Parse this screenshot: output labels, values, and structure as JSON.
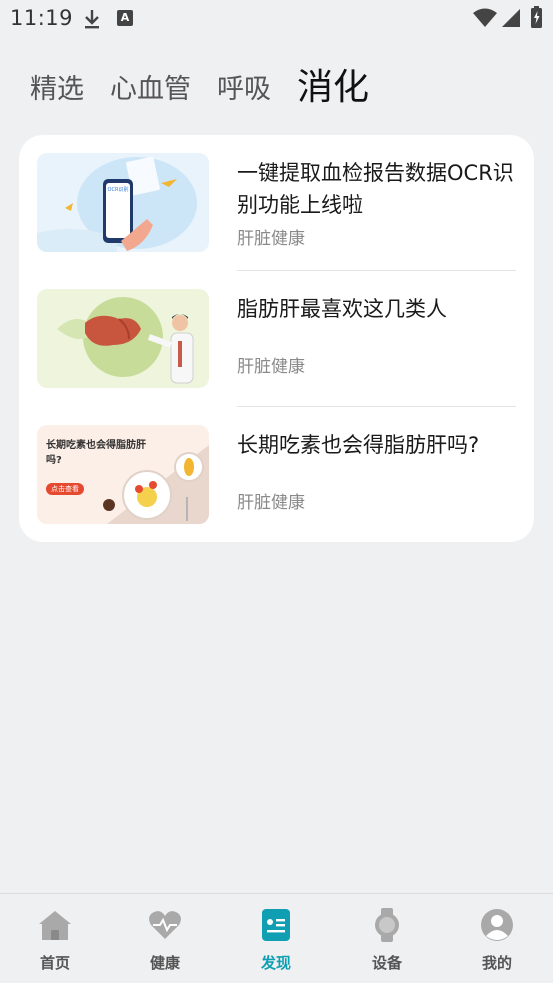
{
  "status_bar": {
    "time": "11:19",
    "icons": [
      "download-icon",
      "app-a-icon",
      "wifi-icon",
      "signal-icon",
      "battery-icon"
    ]
  },
  "tabs": [
    {
      "label": "精选",
      "active": false
    },
    {
      "label": "心血管",
      "active": false
    },
    {
      "label": "呼吸",
      "active": false
    },
    {
      "label": "消化",
      "active": true
    }
  ],
  "articles": [
    {
      "title": "一键提取血检报告数据OCR识别功能上线啦",
      "source": "肝脏健康",
      "thumbnail": {
        "icon": "phone-ocr-illustration",
        "text": "OCR识别"
      }
    },
    {
      "title": "脂肪肝最喜欢这几类人",
      "source": "肝脏健康",
      "thumbnail": {
        "icon": "liver-doctor-illustration"
      }
    },
    {
      "title": "长期吃素也会得脂肪肝吗?",
      "source": "肝脏健康",
      "thumbnail": {
        "icon": "vegetarian-plate-illustration",
        "headline": "长期吃素也会得脂肪肝吗?",
        "button": "点击查看"
      }
    }
  ],
  "bottom_nav": [
    {
      "label": "首页",
      "icon": "home-icon",
      "active": false
    },
    {
      "label": "健康",
      "icon": "heart-pulse-icon",
      "active": false
    },
    {
      "label": "发现",
      "icon": "discover-icon",
      "active": true
    },
    {
      "label": "设备",
      "icon": "watch-icon",
      "active": false
    },
    {
      "label": "我的",
      "icon": "profile-icon",
      "active": false
    }
  ],
  "colors": {
    "background": "#eff0f2",
    "card": "#ffffff",
    "accent": "#109eb3",
    "inactive_icon": "#a9a9a9"
  }
}
